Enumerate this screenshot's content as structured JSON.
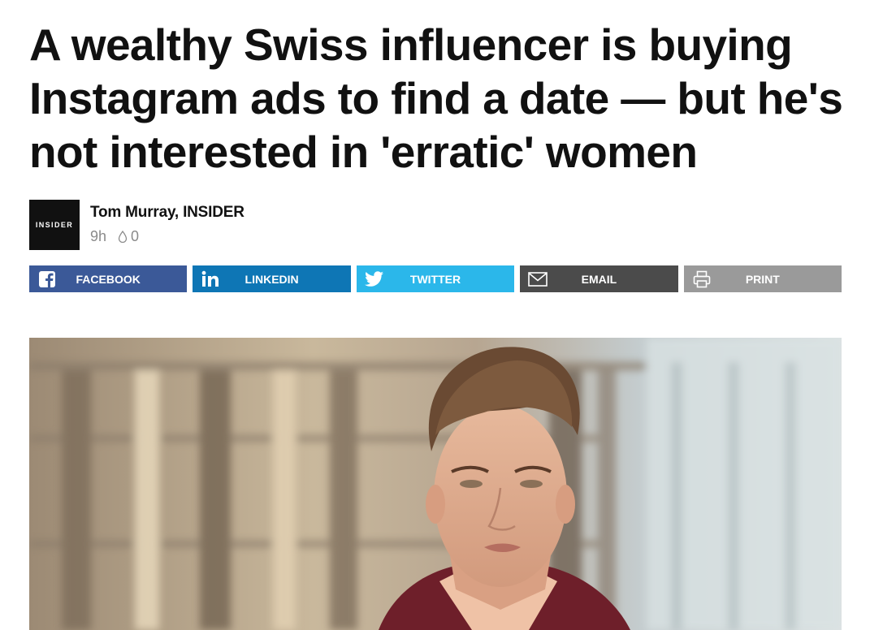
{
  "article": {
    "headline": "A wealthy Swiss influencer is buying Instagram ads to find a date — but he's not interested in 'erratic' women"
  },
  "byline": {
    "logo_text": "INSIDER",
    "author": "Tom Murray, INSIDER",
    "time_ago": "9h",
    "comment_count": "0"
  },
  "share": {
    "facebook": "FACEBOOK",
    "linkedin": "LINKEDIN",
    "twitter": "TWITTER",
    "email": "EMAIL",
    "print": "PRINT"
  },
  "colors": {
    "facebook": "#3b5998",
    "linkedin": "#0e76b5",
    "twitter": "#2bb7ea",
    "email": "#4b4b4b",
    "print": "#9a9a9a"
  }
}
